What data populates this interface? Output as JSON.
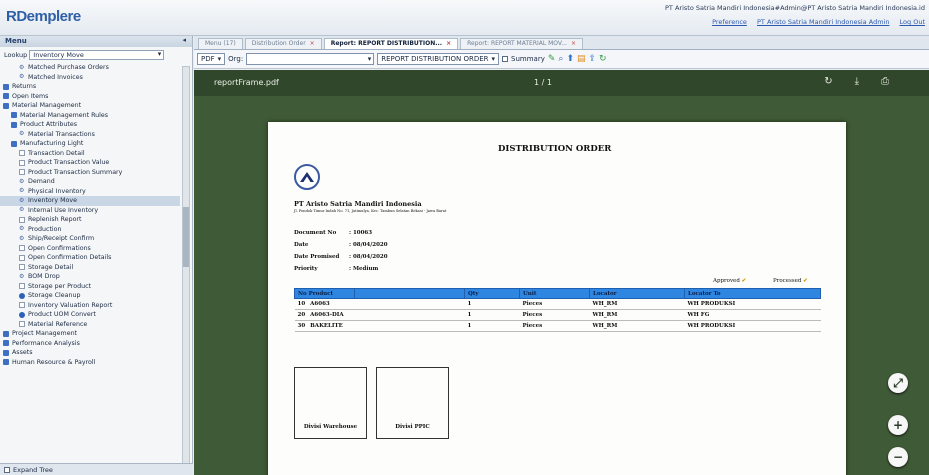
{
  "app": {
    "logo": "RDemplere",
    "user_line": "PT Aristo Satria Mandiri Indonesia#Admin@PT Aristo Satria Mandiri Indonesia.id",
    "links": [
      "Preference",
      "PT Aristo Satria Mandiri Indonesia Admin",
      "Log Out"
    ]
  },
  "sidebar": {
    "menu_label": "Menu",
    "lookup_label": "Lookup",
    "lookup_value": "Inventory Move",
    "tree": [
      {
        "label": "Matched Purchase Orders",
        "icon": "process",
        "indent": 2
      },
      {
        "label": "Matched Invoices",
        "icon": "process",
        "indent": 2
      },
      {
        "label": "Returns",
        "icon": "folder",
        "indent": 0
      },
      {
        "label": "Open Items",
        "icon": "folder",
        "indent": 0
      },
      {
        "label": "Material Management",
        "icon": "folder",
        "indent": 0
      },
      {
        "label": "Material Management Rules",
        "icon": "folder",
        "indent": 1
      },
      {
        "label": "Product Attributes",
        "icon": "folder",
        "indent": 1
      },
      {
        "label": "Material Transactions",
        "icon": "process",
        "indent": 2
      },
      {
        "label": "Manufacturing Light",
        "icon": "folder",
        "indent": 1
      },
      {
        "label": "Transaction Detail",
        "icon": "doc",
        "indent": 2
      },
      {
        "label": "Product Transaction Value",
        "icon": "doc",
        "indent": 2
      },
      {
        "label": "Product Transaction Summary",
        "icon": "doc",
        "indent": 2
      },
      {
        "label": "Demand",
        "icon": "process",
        "indent": 2
      },
      {
        "label": "Physical Inventory",
        "icon": "process",
        "indent": 2
      },
      {
        "label": "Inventory Move",
        "icon": "process",
        "indent": 2,
        "selected": true
      },
      {
        "label": "Internal Use Inventory",
        "icon": "process",
        "indent": 2
      },
      {
        "label": "Replenish Report",
        "icon": "doc",
        "indent": 2
      },
      {
        "label": "Production",
        "icon": "process",
        "indent": 2
      },
      {
        "label": "Ship/Receipt Confirm",
        "icon": "process",
        "indent": 2
      },
      {
        "label": "Open Confirmations",
        "icon": "doc",
        "indent": 2
      },
      {
        "label": "Open Confirmation Details",
        "icon": "doc",
        "indent": 2
      },
      {
        "label": "Storage Detail",
        "icon": "doc",
        "indent": 2
      },
      {
        "label": "BOM Drop",
        "icon": "process",
        "indent": 2
      },
      {
        "label": "Storage per Product",
        "icon": "doc",
        "indent": 2
      },
      {
        "label": "Storage Cleanup",
        "icon": "report",
        "indent": 2
      },
      {
        "label": "Inventory Valuation Report",
        "icon": "doc",
        "indent": 2
      },
      {
        "label": "Product UOM Convert",
        "icon": "report",
        "indent": 2
      },
      {
        "label": "Material Reference",
        "icon": "doc",
        "indent": 2
      },
      {
        "label": "Project Management",
        "icon": "folder",
        "indent": 0
      },
      {
        "label": "Performance Analysis",
        "icon": "folder",
        "indent": 0
      },
      {
        "label": "Assets",
        "icon": "folder",
        "indent": 0
      },
      {
        "label": "Human Resource & Payroll",
        "icon": "folder",
        "indent": 0
      }
    ],
    "footer_label": "Expand Tree"
  },
  "tabs": [
    {
      "label": "Menu (17)",
      "active": false,
      "closable": false
    },
    {
      "label": "Distribution Order",
      "active": false,
      "closable": true
    },
    {
      "label": "Report: REPORT DISTRIBUTION...",
      "active": true,
      "closable": true
    },
    {
      "label": "Report: REPORT MATERIAL MOV...",
      "active": false,
      "closable": true
    }
  ],
  "toolbar": {
    "format_value": "PDF",
    "org_label": "Org:",
    "org_value": "",
    "report_value": "REPORT DISTRIBUTION ORDER",
    "summary_label": "Summary"
  },
  "viewer": {
    "file_name": "reportFrame.pdf",
    "page_indicator": "1 / 1"
  },
  "document": {
    "title": "DISTRIBUTION ORDER",
    "company_name": "PT Aristo Satria Mandiri Indonesia",
    "company_address": "Jl. Pondok Timur Indah No. 71, Jatimulya, Kec. Tambun Selatan Bekasi - Jawa Barat",
    "meta": [
      {
        "key": "Document No",
        "value": ": 10063"
      },
      {
        "key": "Date",
        "value": ": 08/04/2020"
      },
      {
        "key": "Date Promised",
        "value": ": 08/04/2020"
      },
      {
        "key": "Priority",
        "value": ": Medium"
      }
    ],
    "approved_label": "Approved",
    "processed_label": "Processed",
    "columns": [
      "No",
      "Product",
      "Qty",
      "Unit",
      "Locator",
      "Locator To"
    ],
    "rows": [
      {
        "no": "10",
        "product": "A6063",
        "qty": "1",
        "unit": "Pieces",
        "locator": "WH_RM",
        "locator_to": "WH PRODUKSI"
      },
      {
        "no": "20",
        "product": "A6063-DIA",
        "qty": "1",
        "unit": "Pieces",
        "locator": "WH_RM",
        "locator_to": "WH FG"
      },
      {
        "no": "30",
        "product": "BAKELITE",
        "qty": "1",
        "unit": "Pieces",
        "locator": "WH_RM",
        "locator_to": "WH PRODUKSI"
      }
    ],
    "signatures": [
      "Divisi Warehouse",
      "Divisi PPIC"
    ]
  }
}
